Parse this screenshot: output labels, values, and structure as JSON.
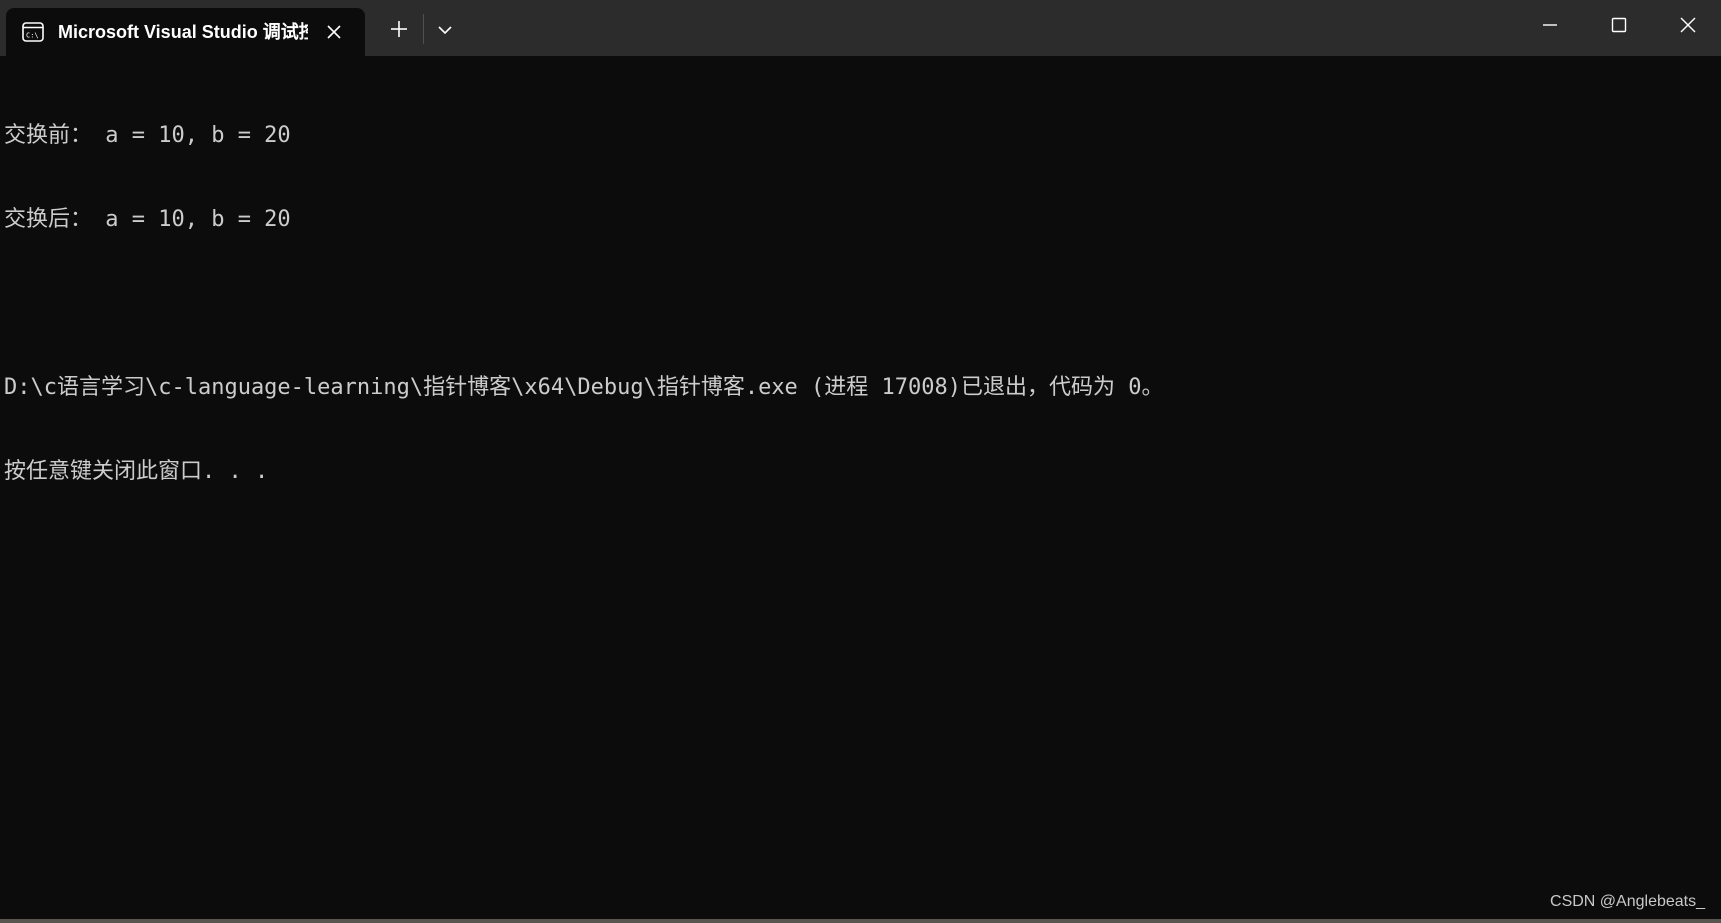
{
  "window": {
    "tab_title": "Microsoft Visual Studio 调试控制台",
    "tab_icon": "console-icon",
    "buttons": {
      "close_tab": "close-icon",
      "new_tab": "plus-icon",
      "dropdown": "chevron-down-icon",
      "minimize": "minimize-icon",
      "maximize": "maximize-icon",
      "close_window": "close-icon"
    }
  },
  "terminal": {
    "lines": [
      "交换前： a = 10, b = 20",
      "交换后： a = 10, b = 20",
      "",
      "D:\\c语言学习\\c-language-learning\\指针博客\\x64\\Debug\\指针博客.exe (进程 17008)已退出，代码为 0。",
      "按任意键关闭此窗口. . ."
    ]
  },
  "watermark": "CSDN @Anglebeats_",
  "colors": {
    "titlebar": "#2c2c2c",
    "background": "#0c0c0c",
    "text": "#cccccc"
  }
}
